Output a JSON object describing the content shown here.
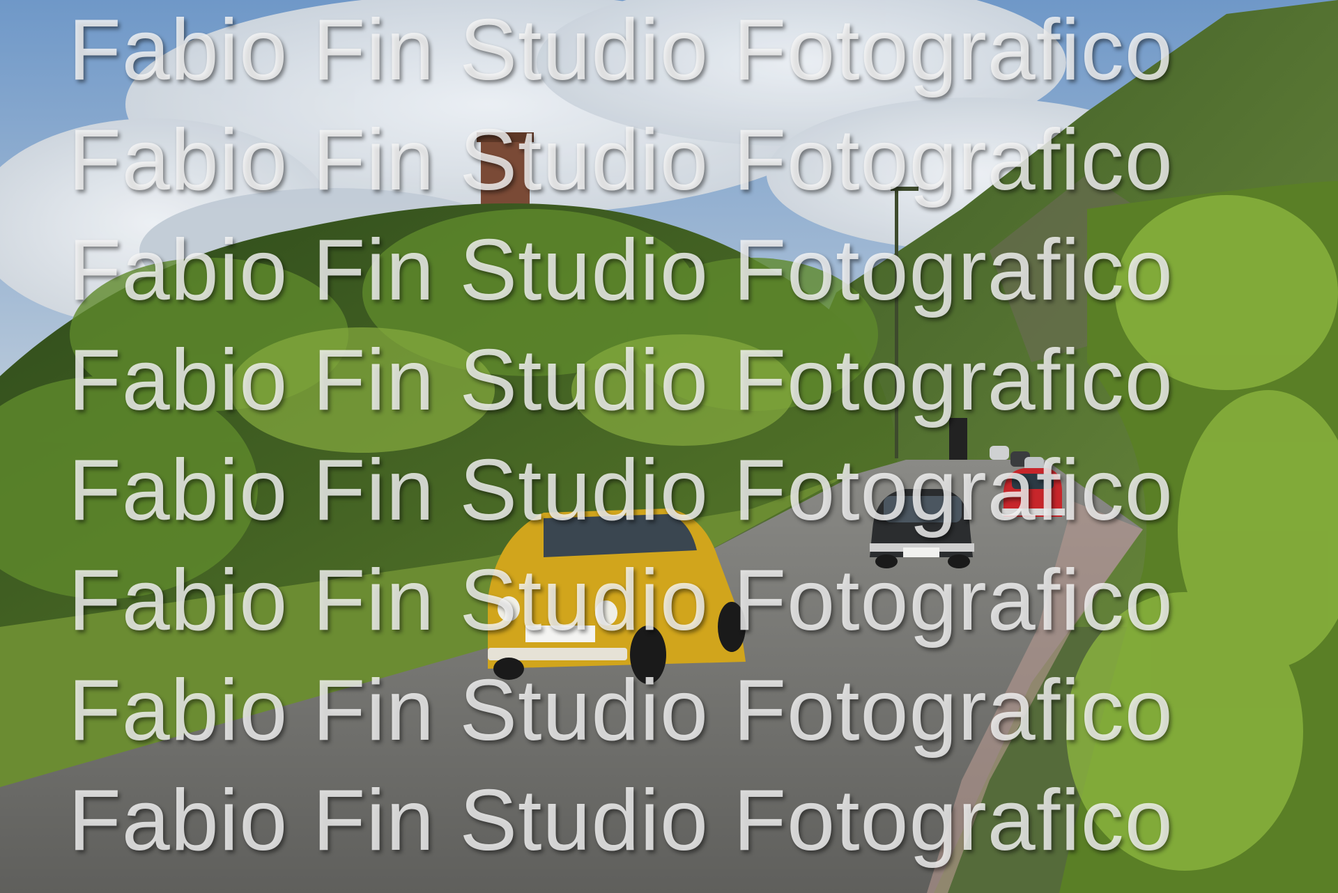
{
  "photo": {
    "subject": "vintage-fiat-500-rally",
    "colors": {
      "sky": "#8fb0d6",
      "cloud": "#eef0f2",
      "foliage_dark": "#2f4a1c",
      "foliage_light": "#7ea23a",
      "road": "#6f6f6c",
      "lead_car": "#d1a51c",
      "second_car": "#2b2d2f",
      "third_car": "#c7262b"
    }
  },
  "watermark": {
    "lines": [
      "Fabio Fin Studio Fotografico",
      "Fabio Fin Studio Fotografico",
      "Fabio Fin Studio Fotografico",
      "Fabio Fin Studio Fotografico",
      "Fabio Fin Studio Fotografico",
      "Fabio Fin Studio Fotografico",
      "Fabio Fin Studio Fotografico",
      "Fabio Fin Studio Fotografico"
    ]
  }
}
